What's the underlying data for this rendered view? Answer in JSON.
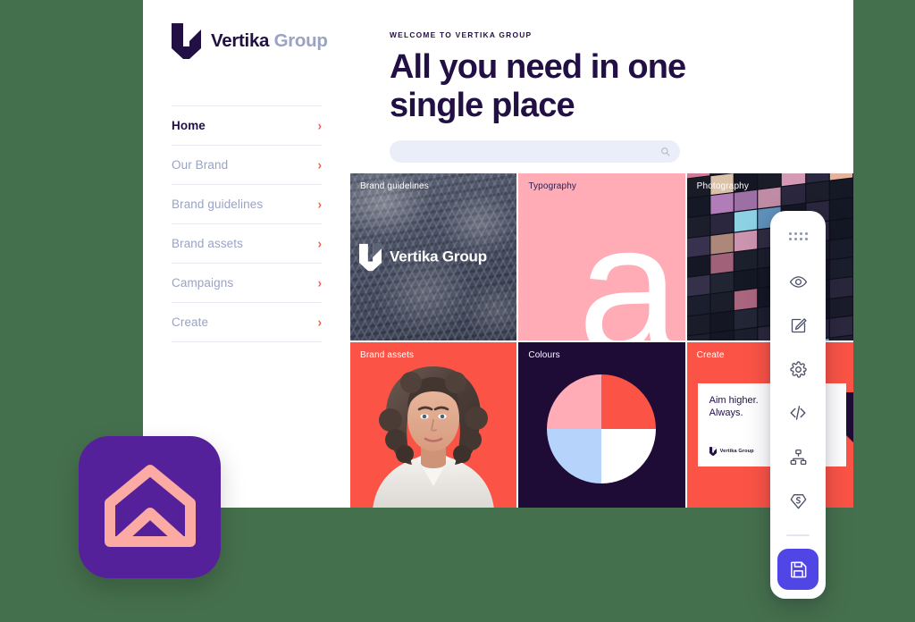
{
  "theme": {
    "page_background": "#45704d",
    "brand_dark": "#221044",
    "brand_muted": "#9aa3c4",
    "accent_coral": "#fb5446",
    "accent_pink": "#ffacb7",
    "accent_blue": "#b6d4fb",
    "accent_navy": "#1e0b36",
    "accent_indigo": "#4f46e5",
    "app_icon_purple": "#55219b",
    "app_icon_glyph_pink": "#fcaaa4",
    "search_field_bg": "#eaeef8"
  },
  "sidebar": {
    "brand": {
      "mark": "vertika-logo-mark",
      "name_primary": "Vertika",
      "name_secondary": "Group"
    },
    "items": [
      {
        "label": "Home",
        "active": true,
        "chevron": "chevron-right-icon"
      },
      {
        "label": "Our Brand",
        "active": false,
        "chevron": "chevron-right-icon"
      },
      {
        "label": "Brand guidelines",
        "active": false,
        "chevron": "chevron-right-icon"
      },
      {
        "label": "Brand assets",
        "active": false,
        "chevron": "chevron-right-icon"
      },
      {
        "label": "Campaigns",
        "active": false,
        "chevron": "chevron-right-icon"
      },
      {
        "label": "Create",
        "active": false,
        "chevron": "chevron-right-icon"
      }
    ]
  },
  "header": {
    "eyebrow": "WELCOME TO VERTIKA GROUP",
    "title": "All you need in one single place"
  },
  "search": {
    "value": "",
    "placeholder": "",
    "icon": "search-icon"
  },
  "tiles": [
    {
      "label": "Brand guidelines",
      "kind": "photo-forest",
      "label_tone": "light",
      "overlay_logo_text": "Vertika Group"
    },
    {
      "label": "Typography",
      "kind": "typography",
      "label_tone": "dark",
      "glyph": "a"
    },
    {
      "label": "Photography",
      "kind": "photo-night-building",
      "label_tone": "light"
    },
    {
      "label": "Brand assets",
      "kind": "photo-portrait",
      "label_tone": "light"
    },
    {
      "label": "Colours",
      "kind": "pie",
      "label_tone": "light"
    },
    {
      "label": "Create",
      "kind": "quote-card",
      "label_tone": "light"
    }
  ],
  "colours_pie": {
    "type": "pie",
    "title": "Colours",
    "categories": [
      "Pink",
      "Coral red",
      "White",
      "Light blue"
    ],
    "values": [
      25,
      25,
      25,
      25
    ],
    "colors": [
      "#ffacb7",
      "#fb5446",
      "#ffffff",
      "#b6d4fb"
    ],
    "legend": "none"
  },
  "quote_card": {
    "line1": "Aim higher.",
    "line2": "Always.",
    "brand_mark": "vertika-logo-mark",
    "brand_text": "Vertika Group"
  },
  "toolbar": {
    "drag_handle": "drag-dots-icon",
    "buttons": [
      {
        "name": "preview-button",
        "icon": "eye-icon"
      },
      {
        "name": "edit-button",
        "icon": "edit-square-icon"
      },
      {
        "name": "settings-button",
        "icon": "gear-icon"
      },
      {
        "name": "code-button",
        "icon": "code-icon"
      },
      {
        "name": "sitemap-button",
        "icon": "sitemap-icon"
      },
      {
        "name": "sketch-button",
        "icon": "sketch-diamond-icon"
      }
    ],
    "save": {
      "name": "save-button",
      "icon": "floppy-save-icon"
    }
  },
  "app_icon": {
    "name": "app-launcher-icon",
    "glyph": "house-chevron-icon"
  }
}
